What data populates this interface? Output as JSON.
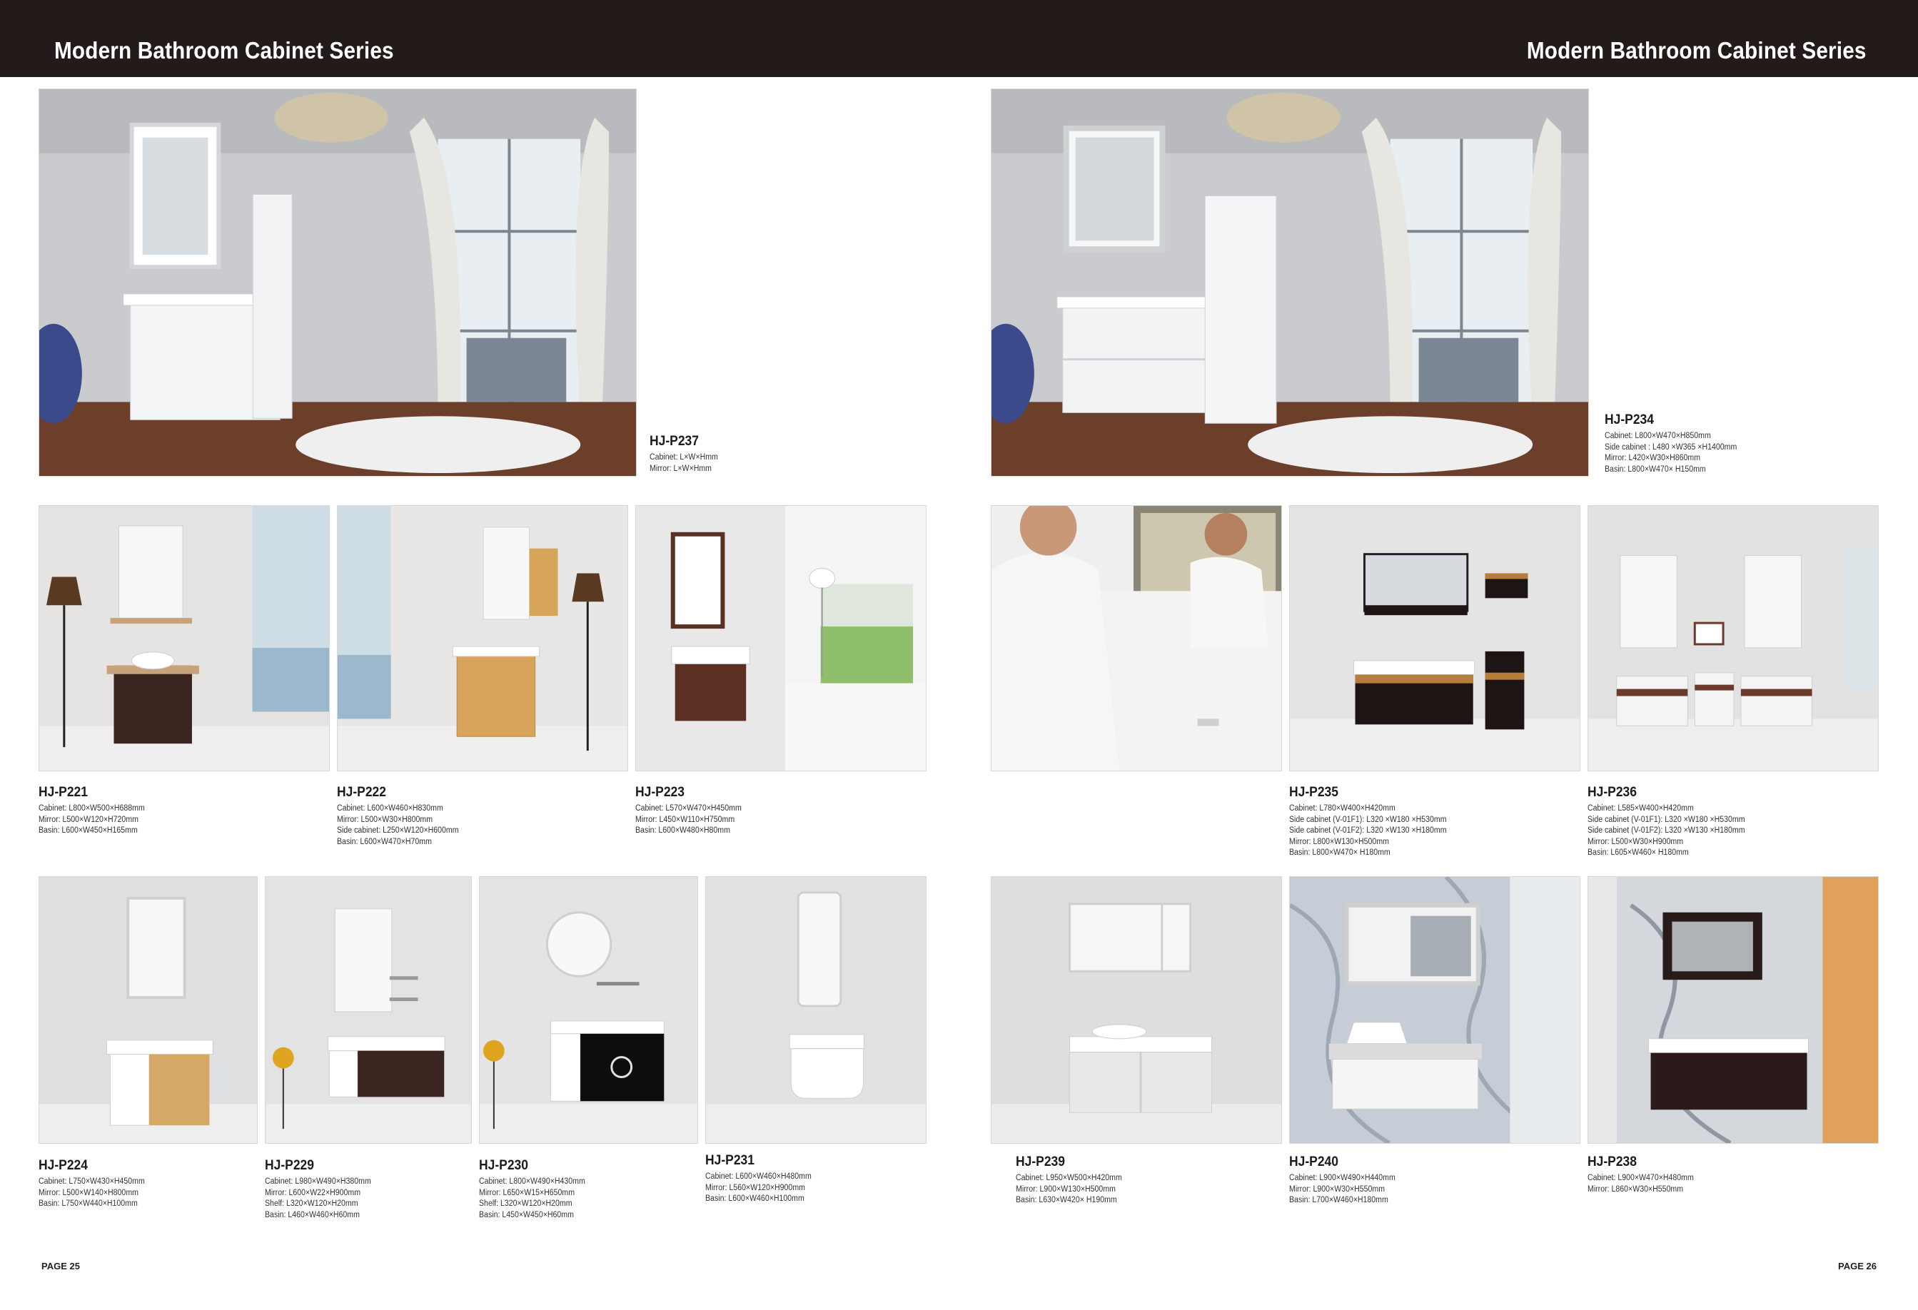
{
  "header": {
    "left_title": "Modern Bathroom Cabinet Series",
    "right_title": "Modern Bathroom Cabinet Series"
  },
  "products": [
    {
      "code": "HJ-P237",
      "specs": [
        "Cabinet: L×W×Hmm",
        "Mirror: L×W×Hmm"
      ]
    },
    {
      "code": "HJ-P234",
      "specs": [
        "Cabinet: L800×W470×H850mm",
        "Side cabinet : L480 ×W365 ×H1400mm",
        "Mirror: L420×W30×H860mm",
        "Basin: L800×W470× H150mm"
      ]
    },
    {
      "code": "HJ-P221",
      "specs": [
        "Cabinet: L800×W500×H688mm",
        "Mirror: L500×W120×H720mm",
        "Basin: L600×W450×H165mm"
      ]
    },
    {
      "code": "HJ-P222",
      "specs": [
        "Cabinet: L600×W460×H830mm",
        "Mirror: L500×W30×H800mm",
        "Side cabinet: L250×W120×H600mm",
        "Basin: L600×W470×H70mm"
      ]
    },
    {
      "code": "HJ-P223",
      "specs": [
        "Cabinet: L570×W470×H450mm",
        "Mirror: L450×W110×H750mm",
        "Basin: L600×W480×H80mm"
      ]
    },
    {
      "code": "HJ-P235",
      "specs": [
        "Cabinet: L780×W400×H420mm",
        "Side cabinet (V-01F1): L320 ×W180 ×H530mm",
        "Side cabinet (V-01F2): L320 ×W130 ×H180mm",
        "Mirror: L800×W130×H500mm",
        "Basin: L800×W470× H180mm"
      ]
    },
    {
      "code": "HJ-P236",
      "specs": [
        "Cabinet: L585×W400×H420mm",
        "Side cabinet (V-01F1): L320 ×W180 ×H530mm",
        "Side cabinet (V-01F2): L320 ×W130 ×H180mm",
        "Mirror: L500×W30×H900mm",
        "Basin: L605×W460× H180mm"
      ]
    },
    {
      "code": "HJ-P224",
      "specs": [
        "Cabinet: L750×W430×H450mm",
        "Mirror: L500×W140×H800mm",
        "Basin: L750×W440×H100mm"
      ]
    },
    {
      "code": "HJ-P229",
      "specs": [
        "Cabinet: L980×W490×H380mm",
        "Mirror: L600×W22×H900mm",
        "Shelf: L320×W120×H20mm",
        "Basin: L460×W460×H60mm"
      ]
    },
    {
      "code": "HJ-P230",
      "specs": [
        "Cabinet: L800×W490×H430mm",
        "Mirror: L650×W15×H650mm",
        "Shelf: L320×W120×H20mm",
        "Basin: L450×W450×H60mm"
      ]
    },
    {
      "code": "HJ-P231",
      "specs": [
        "Cabinet: L600×W460×H480mm",
        "Mirror: L560×W120×H900mm",
        "Basin: L600×W460×H100mm"
      ]
    },
    {
      "code": "HJ-P239",
      "specs": [
        "Cabinet: L950×W500×H420mm",
        "Mirror: L900×W130×H500mm",
        "Basin: L630×W420× H190mm"
      ]
    },
    {
      "code": "HJ-P240",
      "specs": [
        "Cabinet: L900×W490×H440mm",
        "Mirror: L900×W30×H550mm",
        "Basin: L700×W460×H180mm"
      ]
    },
    {
      "code": "HJ-P238",
      "specs": [
        "Cabinet: L900×W470×H480mm",
        "Mirror: L860×W30×H550mm"
      ]
    }
  ],
  "footer": {
    "left_page": "PAGE 25",
    "right_page": "PAGE 26"
  }
}
